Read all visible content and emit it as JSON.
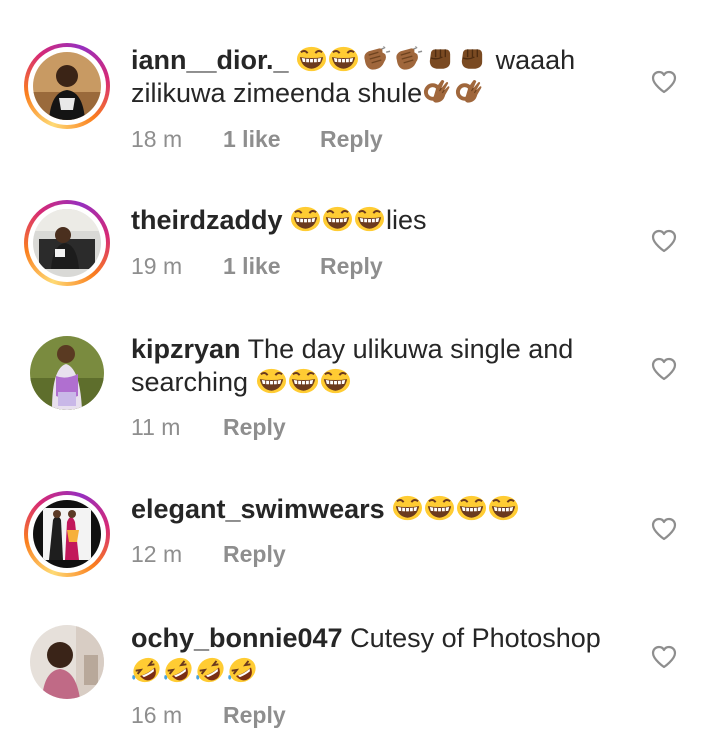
{
  "comments": [
    {
      "username": "iann__dior._",
      "text_line1": "waaah",
      "text_line2": "zilikuwa zimeenda shule",
      "time": "18 m",
      "likes": "1 like",
      "reply": "Reply",
      "emojis_line1": [
        "grin-laugh",
        "grin-laugh",
        "clap",
        "clap",
        "fist",
        "fist"
      ],
      "emojis_line2": [
        "ok-hand",
        "ok-hand"
      ]
    },
    {
      "username": "theirdzaddy",
      "text": "lies",
      "time": "19 m",
      "likes": "1 like",
      "reply": "Reply",
      "emojis": [
        "grin-laugh",
        "grin-laugh",
        "grin-laugh"
      ]
    },
    {
      "username": "kipzryan",
      "text_line1": "The day ulikuwa single and",
      "text_line2": "searching",
      "time": "11 m",
      "reply": "Reply",
      "emojis": [
        "grin-laugh",
        "grin-laugh",
        "grin-laugh"
      ]
    },
    {
      "username": "elegant_swimwears",
      "time": "12 m",
      "reply": "Reply",
      "emojis": [
        "grin-laugh",
        "grin-laugh",
        "grin-laugh",
        "grin-laugh"
      ]
    },
    {
      "username": "ochy_bonnie047",
      "text": "Cutesy of Photoshop",
      "time": "16 m",
      "reply": "Reply",
      "emojis": [
        "rofl",
        "rofl",
        "rofl",
        "rofl"
      ]
    }
  ],
  "icons": {
    "like": "heart-outline-icon"
  },
  "colors": {
    "text": "#262626",
    "meta": "#8e8e8e",
    "emoji_face": "#ffcc33",
    "skin": "#a0673c"
  }
}
